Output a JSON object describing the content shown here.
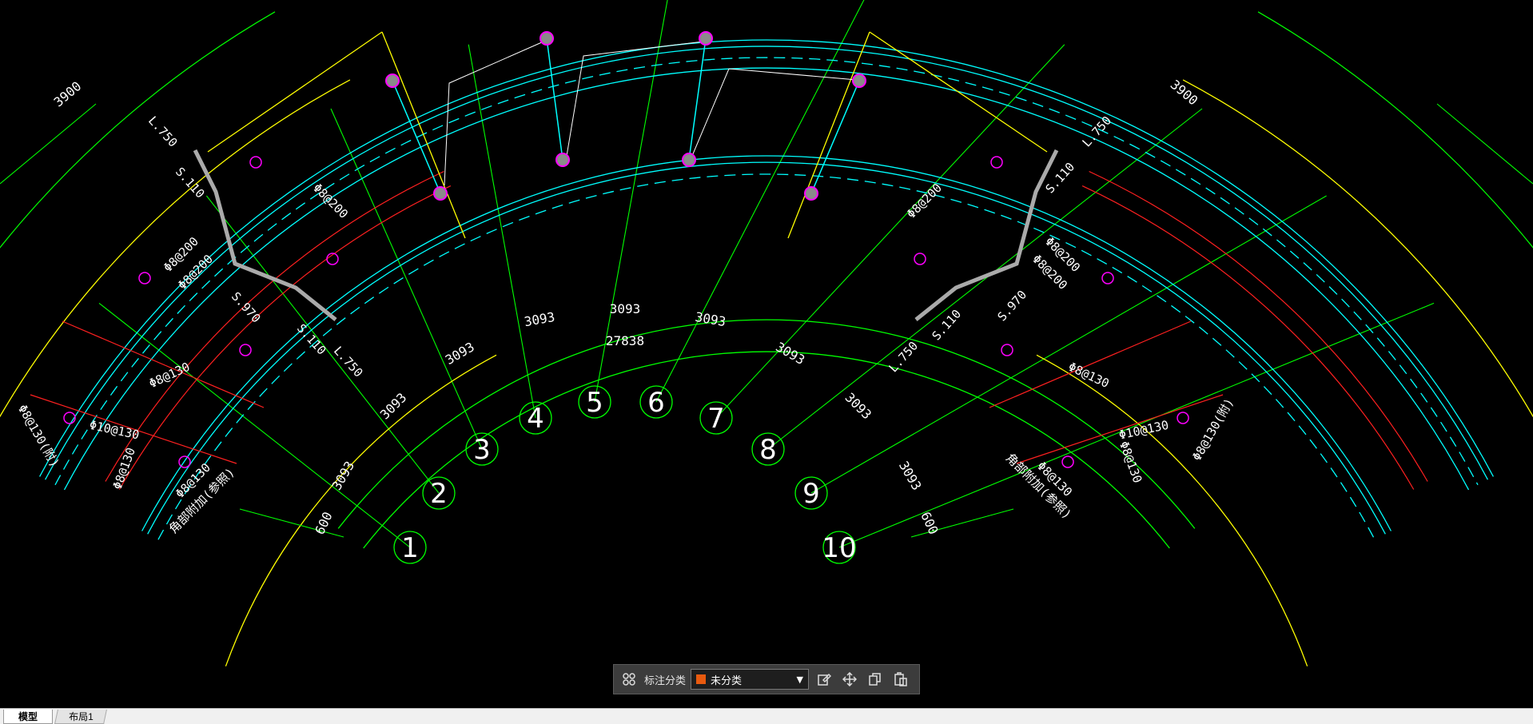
{
  "toolbar": {
    "category_label": "标注分类",
    "category_value": "未分类",
    "category_color": "#e85a0f",
    "icons": [
      "grid-icon",
      "edit-icon",
      "move-icon",
      "copy-icon",
      "paste-icon"
    ]
  },
  "tabs": {
    "model": "模型",
    "layout1": "布局1"
  },
  "drawing": {
    "axis_labels": [
      "1",
      "2",
      "3",
      "4",
      "5",
      "6",
      "7",
      "8",
      "9",
      "10"
    ],
    "dim_segment": "3093",
    "dim_total": "27838",
    "dim_edge": "600",
    "dim_radial": "3900",
    "elevations": {
      "l750": "L.750",
      "s110": "S.110",
      "s970": "S.970"
    },
    "rebar": {
      "phi8_200": "Φ8@200",
      "phi8_130": "Φ8@130",
      "phi10_130": "Φ10@130",
      "phi8_130b": "Φ8@130(附)"
    },
    "notes": {
      "corner_bar": "角部附加(参照)",
      "corner_bar_r": "角部附加(参照)"
    }
  },
  "colors": {
    "axis": "#00ff00",
    "beam": "#00ffff",
    "rebar": "#ff2020",
    "outline": "#ffff00",
    "column": "#ff00ff",
    "background": "#000000"
  }
}
